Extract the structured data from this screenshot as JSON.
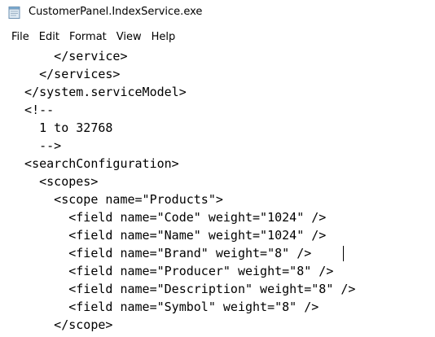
{
  "window": {
    "title": "CustomerPanel.IndexService.exe",
    "icon": "notepad-document-icon"
  },
  "menu": [
    {
      "label": "File"
    },
    {
      "label": "Edit"
    },
    {
      "label": "Format"
    },
    {
      "label": "View"
    },
    {
      "label": "Help"
    }
  ],
  "editor": {
    "lines": [
      "      </service>",
      "    </services>",
      "  </system.serviceModel>",
      "  <!--",
      "    1 to 32768",
      "    -->",
      "  <searchConfiguration>",
      "    <scopes>",
      "      <scope name=\"Products\">",
      "        <field name=\"Code\" weight=\"1024\" />",
      "        <field name=\"Name\" weight=\"1024\" />",
      "        <field name=\"Brand\" weight=\"8\" />",
      "        <field name=\"Producer\" weight=\"8\" />",
      "        <field name=\"Description\" weight=\"8\" />",
      "        <field name=\"Symbol\" weight=\"8\" />",
      "      </scope>"
    ],
    "caret": {
      "line": 11
    }
  }
}
